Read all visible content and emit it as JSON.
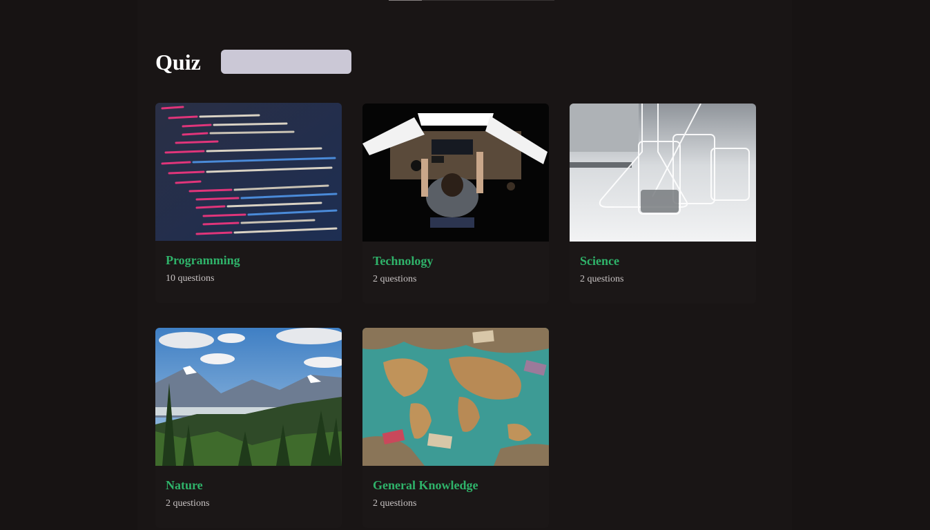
{
  "page": {
    "title": "Quiz",
    "search_placeholder": ""
  },
  "cards": [
    {
      "title": "Programming",
      "count": "10 questions",
      "image": "code-screen-image"
    },
    {
      "title": "Technology",
      "count": "2 questions",
      "image": "desk-monitors-image"
    },
    {
      "title": "Science",
      "count": "2 questions",
      "image": "lab-glassware-image"
    },
    {
      "title": "Nature",
      "count": "2 questions",
      "image": "mountain-valley-image"
    },
    {
      "title": "General Knowledge",
      "count": "2 questions",
      "image": "world-map-money-image"
    }
  ],
  "colors": {
    "background": "#171313",
    "card_title": "#2fb36a",
    "search_bg": "#cbc8d6"
  }
}
